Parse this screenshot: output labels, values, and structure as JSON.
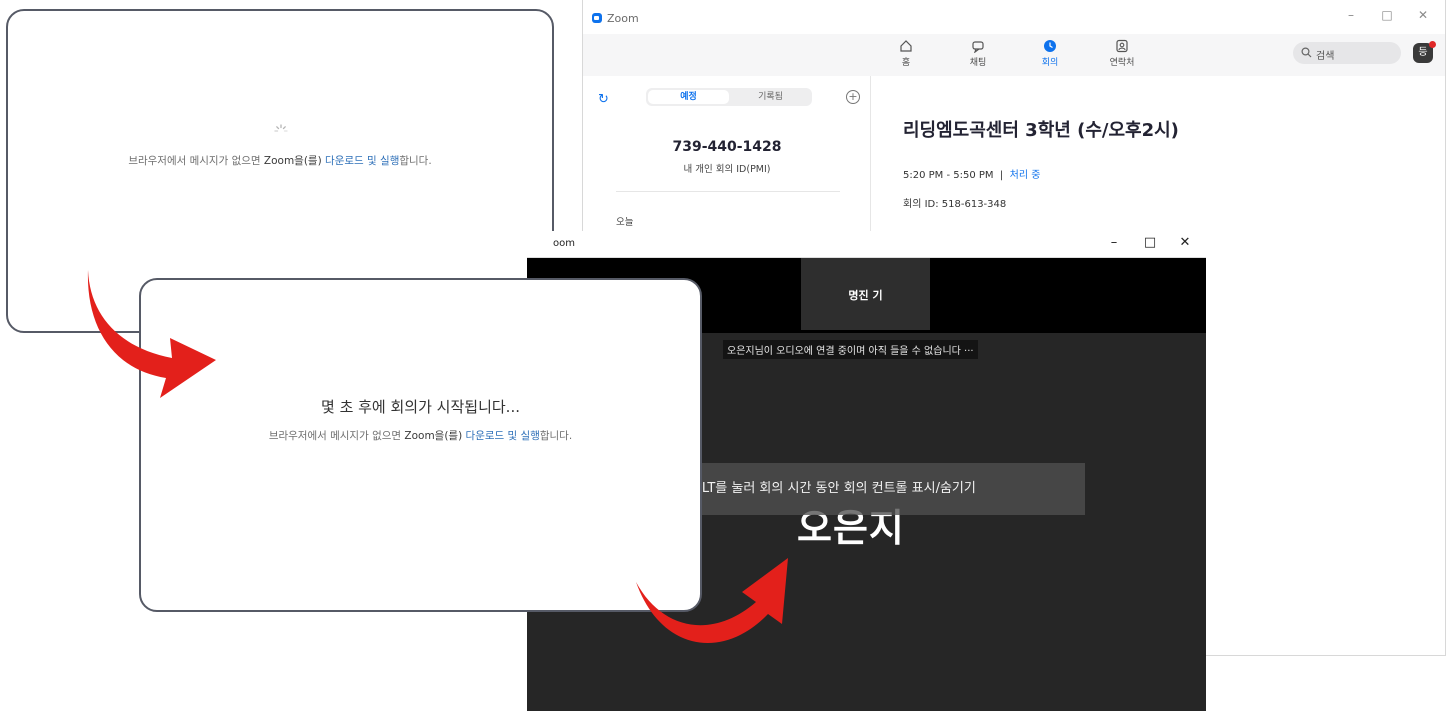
{
  "zoom_main": {
    "window_title": "Zoom",
    "window_controls": {
      "minimize": "–",
      "maximize": "□",
      "close": "✕"
    },
    "nav_tabs": [
      {
        "label": "홈",
        "icon": "home-icon"
      },
      {
        "label": "채팅",
        "icon": "chat-icon"
      },
      {
        "label": "회의",
        "icon": "clock-icon",
        "active": true
      },
      {
        "label": "연락처",
        "icon": "contacts-icon"
      }
    ],
    "search_placeholder": "검색",
    "avatar_initial": "등",
    "segment": {
      "upcoming": "예정",
      "recorded": "기록됨"
    },
    "pmi": {
      "number": "739-440-1428",
      "label": "내 개인 회의 ID(PMI)"
    },
    "today_label": "오늘",
    "meeting": {
      "title": "리딩엠도곡센터 3학년 (수/오후2시)",
      "time": "5:20 PM - 5:50 PM",
      "separator": "|",
      "status": "처리 중",
      "id_line": "회의 ID: 518-613-348"
    }
  },
  "panel1": {
    "msg_prefix": "브라우저에서 메시지가 없으면 ",
    "msg_brand": "Zoom을(를)",
    "msg_download": "다운로드",
    "msg_and": " 및 ",
    "msg_run": "실행",
    "msg_suffix": "합니다."
  },
  "panel2": {
    "heading": "몇 초 후에 회의가 시작됩니다...",
    "msg_prefix": "브라우저에서 메시지가 없으면 ",
    "msg_brand": "Zoom을(를)",
    "msg_download": "다운로드",
    "msg_and": " 및 ",
    "msg_run": "실행",
    "msg_suffix": "합니다."
  },
  "meeting_window": {
    "title": "oom",
    "controls": {
      "minimize": "–",
      "maximize": "□",
      "close": "✕"
    },
    "tile_name": "명진 기",
    "audio_notice": "오은지님이 오디오에 연결 중이며 아직 들을 수 없습니다 ···",
    "alt_hint": "ALT를 눌러 회의 시간 동안 회의 컨트롤 표시/숨기기",
    "big_name": "오은지"
  },
  "colors": {
    "zoom_blue": "#0e72ed",
    "link_blue": "#2d6fb8",
    "arrow_red": "#e3201b",
    "meeting_bg": "#262626"
  }
}
